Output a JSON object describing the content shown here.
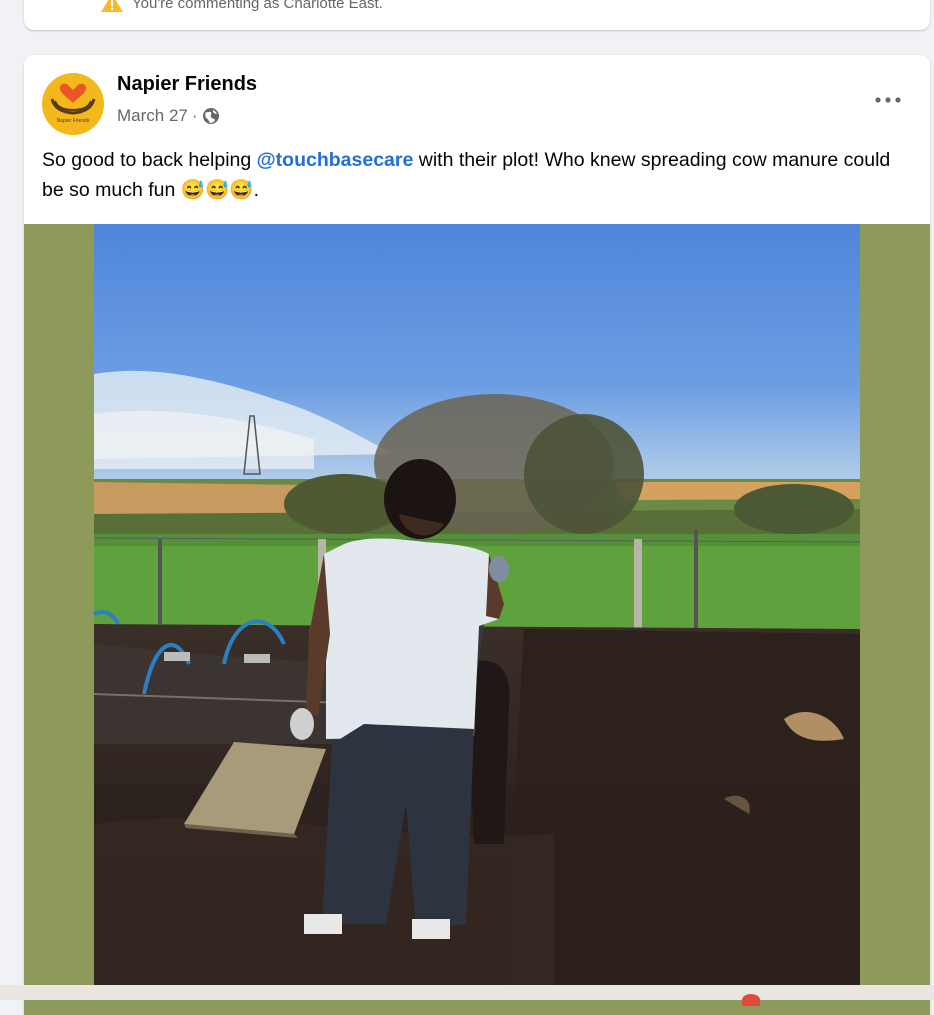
{
  "comment_notice": {
    "text": "You're commenting as Charlotte East.",
    "icon": "warning-icon"
  },
  "post": {
    "author": "Napier Friends",
    "avatar_text": "Napier Friends",
    "date": "March 27",
    "separator": "·",
    "audience_icon": "globe-icon",
    "menu_icon": "more-options-icon",
    "text_before": "So good to back helping ",
    "mention": "@touchbasecare",
    "text_after": " with their plot! Who knew spreading cow manure could be so much fun ",
    "emojis": "😅😅😅",
    "text_end": ".",
    "photo_description_icon": "post-photo"
  },
  "colors": {
    "mention": "#216fdb",
    "photo_border": "#8e9a5a",
    "avatar_bg": "#f3b81c"
  }
}
